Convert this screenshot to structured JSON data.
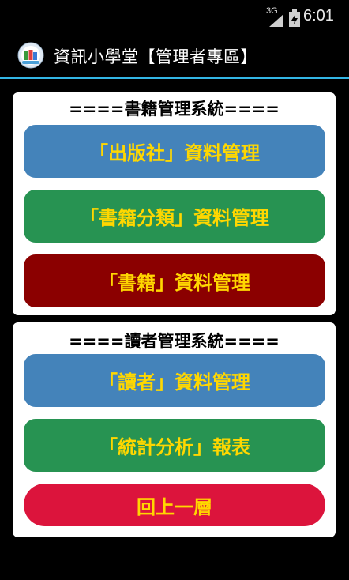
{
  "status_bar": {
    "network": "3G",
    "time": "6:01"
  },
  "action_bar": {
    "title": "資訊小學堂【管理者專區】"
  },
  "book_system": {
    "heading": "====書籍管理系統====",
    "buttons": [
      {
        "label": "「出版社」資料管理",
        "color": "#4483ba"
      },
      {
        "label": "「書籍分類」資料管理",
        "color": "#279352"
      },
      {
        "label": "「書籍」資料管理",
        "color": "#8b0000"
      }
    ]
  },
  "reader_system": {
    "heading": "====讀者管理系統====",
    "buttons": [
      {
        "label": "「讀者」資料管理",
        "color": "#4483ba"
      },
      {
        "label": "「統計分析」報表",
        "color": "#279352"
      },
      {
        "label": "回上一層",
        "color": "#dc143c"
      }
    ]
  },
  "colors": {
    "button_text": "#ffd700",
    "accent_line": "#33b5e5"
  }
}
